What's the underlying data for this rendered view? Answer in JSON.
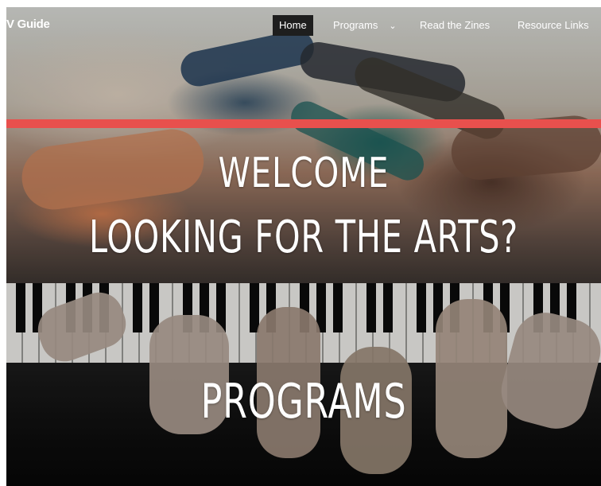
{
  "nav": {
    "brand": "V Guide",
    "items": [
      {
        "label": "Home",
        "active": true
      },
      {
        "label": "Programs",
        "has_dropdown": true
      },
      {
        "label": "Read the Zines"
      },
      {
        "label": "Resource Links"
      }
    ]
  },
  "hero_welcome": {
    "line1": "WELCOME",
    "line2": "LOOKING FOR THE ARTS?"
  },
  "hero_programs": {
    "title": "PROGRAMS"
  },
  "colors": {
    "accent_bar": "#e8504d",
    "nav_active_bg": "#1e1e1e",
    "text": "#ffffff"
  }
}
